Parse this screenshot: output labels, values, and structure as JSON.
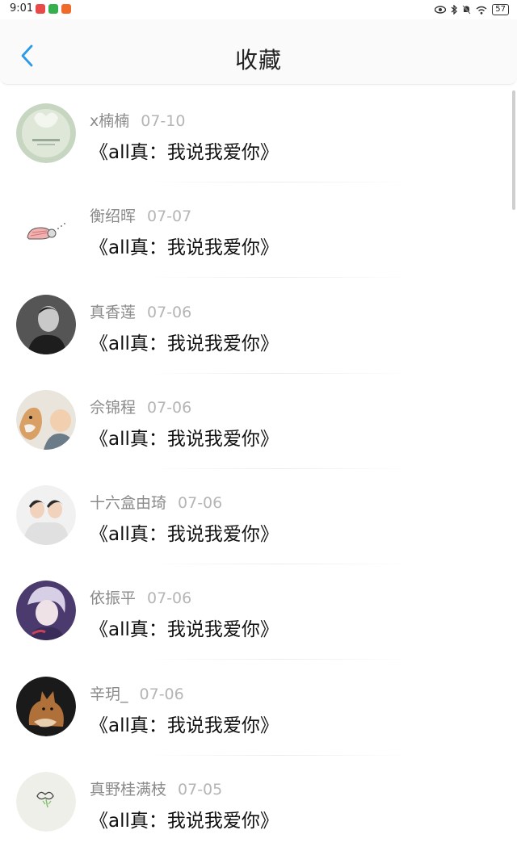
{
  "status": {
    "time": "9:01",
    "battery": "57"
  },
  "header": {
    "title": "收藏"
  },
  "items": [
    {
      "name": "x楠楠",
      "date": "07-10",
      "text": "《all真：我说我爱你》"
    },
    {
      "name": "衡绍晖",
      "date": "07-07",
      "text": "《all真：我说我爱你》"
    },
    {
      "name": "真香莲",
      "date": "07-06",
      "text": "《all真：我说我爱你》"
    },
    {
      "name": "佘锦程",
      "date": "07-06",
      "text": "《all真：我说我爱你》"
    },
    {
      "name": "十六盒由琦",
      "date": "07-06",
      "text": "《all真：我说我爱你》"
    },
    {
      "name": "依振平",
      "date": "07-06",
      "text": "《all真：我说我爱你》"
    },
    {
      "name": "辛玥_",
      "date": "07-06",
      "text": "《all真：我说我爱你》"
    },
    {
      "name": "真野桂满枝",
      "date": "07-05",
      "text": "《all真：我说我爱你》"
    }
  ]
}
